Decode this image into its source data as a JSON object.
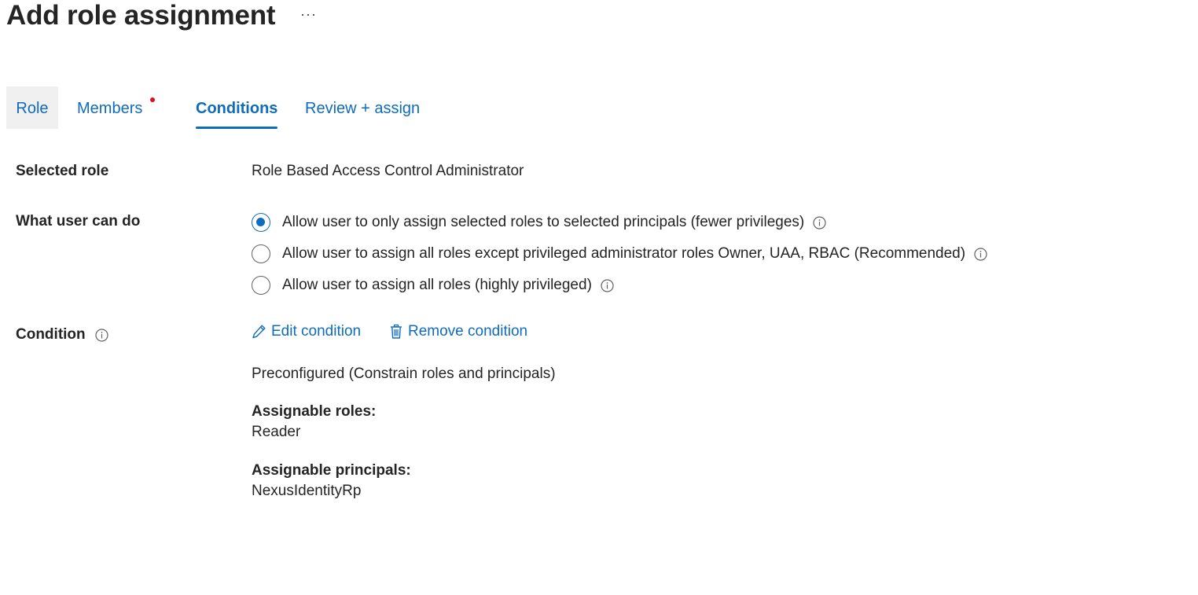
{
  "header": {
    "title": "Add role assignment",
    "more_label": "···"
  },
  "tabs": [
    {
      "label": "Role"
    },
    {
      "label": "Members",
      "has_error_dot": true
    },
    {
      "label": "Conditions",
      "selected": true
    },
    {
      "label": "Review + assign"
    }
  ],
  "selected_role": {
    "label": "Selected role",
    "value": "Role Based Access Control Administrator"
  },
  "what_user_can_do": {
    "label": "What user can do",
    "options": [
      {
        "label": "Allow user to only assign selected roles to selected principals (fewer privileges)",
        "checked": true,
        "icon": "info-icon"
      },
      {
        "label": "Allow user to assign all roles except privileged administrator roles Owner, UAA, RBAC (Recommended)",
        "checked": false,
        "icon": "info-icon"
      },
      {
        "label": "Allow user to assign all roles (highly privileged)",
        "checked": false,
        "icon": "info-icon"
      }
    ]
  },
  "condition": {
    "label": "Condition",
    "edit_label": "Edit condition",
    "remove_label": "Remove condition",
    "summary": "Preconfigured (Constrain roles and principals)",
    "assignable_roles_label": "Assignable roles:",
    "assignable_roles_value": "Reader",
    "assignable_principals_label": "Assignable principals:",
    "assignable_principals_value": "NexusIdentityRp"
  },
  "colors": {
    "accent": "#0f6cbd",
    "error_dot": "#e00b1c",
    "text": "#242424"
  }
}
